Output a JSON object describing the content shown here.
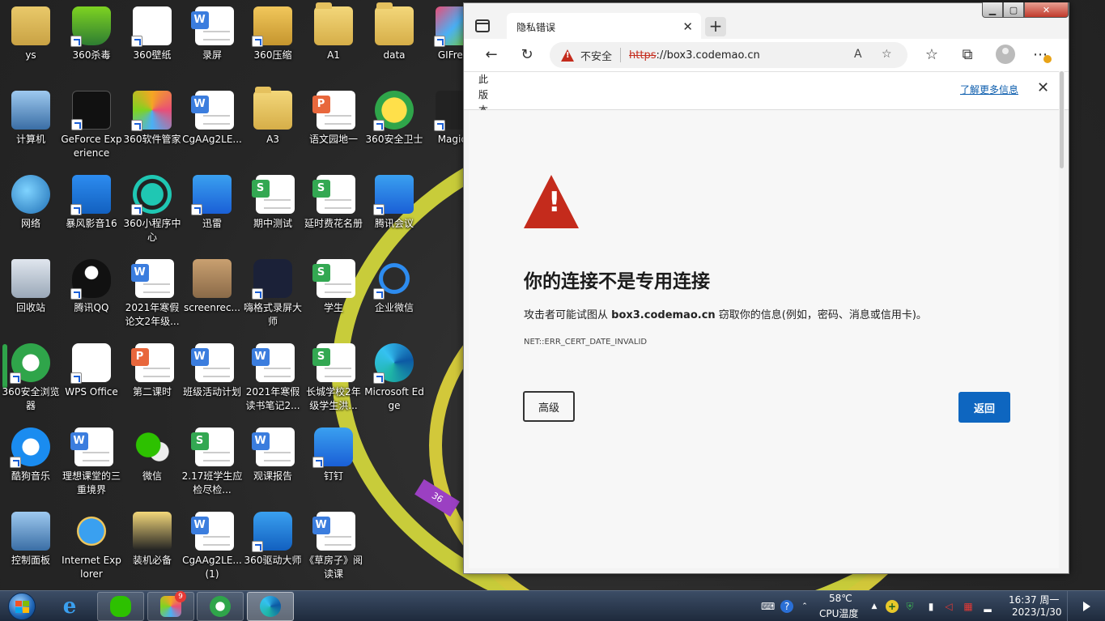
{
  "desktop": {
    "ring_tag": "36",
    "icons": [
      {
        "label": "ys",
        "kind": "user",
        "col": 0,
        "row": 0,
        "shortcut": false
      },
      {
        "label": "360杀毒",
        "kind": "shield-green",
        "col": 1,
        "row": 0,
        "shortcut": true
      },
      {
        "label": "360壁纸",
        "kind": "wallpaper",
        "col": 2,
        "row": 0,
        "shortcut": true
      },
      {
        "label": "录屏",
        "kind": "doc-w",
        "col": 3,
        "row": 0,
        "shortcut": false
      },
      {
        "label": "360压缩",
        "kind": "zip",
        "col": 4,
        "row": 0,
        "shortcut": true
      },
      {
        "label": "A1",
        "kind": "folder",
        "col": 5,
        "row": 0,
        "shortcut": false
      },
      {
        "label": "data",
        "kind": "folder",
        "col": 6,
        "row": 0,
        "shortcut": false
      },
      {
        "label": "GIFrect",
        "kind": "gif",
        "col": 7,
        "row": 0,
        "shortcut": true
      },
      {
        "label": "计算机",
        "kind": "computer",
        "col": 0,
        "row": 1,
        "shortcut": false
      },
      {
        "label": "GeForce Experience",
        "kind": "nvidia",
        "col": 1,
        "row": 1,
        "shortcut": true
      },
      {
        "label": "360软件管家",
        "kind": "360soft",
        "col": 2,
        "row": 1,
        "shortcut": true
      },
      {
        "label": "CgAAg2LE...",
        "kind": "doc-w",
        "col": 3,
        "row": 1,
        "shortcut": false
      },
      {
        "label": "A3",
        "kind": "folder",
        "col": 4,
        "row": 1,
        "shortcut": false
      },
      {
        "label": "语文园地一",
        "kind": "doc-p",
        "col": 5,
        "row": 1,
        "shortcut": false
      },
      {
        "label": "360安全卫士",
        "kind": "360safe",
        "col": 6,
        "row": 1,
        "shortcut": true
      },
      {
        "label": "Magica",
        "kind": "magica",
        "col": 7,
        "row": 1,
        "shortcut": true
      },
      {
        "label": "网络",
        "kind": "network",
        "col": 0,
        "row": 2,
        "shortcut": false
      },
      {
        "label": "暴风影音16",
        "kind": "baofeng",
        "col": 1,
        "row": 2,
        "shortcut": true
      },
      {
        "label": "360小程序中心",
        "kind": "360mini",
        "col": 2,
        "row": 2,
        "shortcut": true
      },
      {
        "label": "迅雷",
        "kind": "xunlei",
        "col": 3,
        "row": 2,
        "shortcut": true
      },
      {
        "label": "期中测试",
        "kind": "doc-s",
        "col": 4,
        "row": 2,
        "shortcut": false
      },
      {
        "label": "延时费花名册",
        "kind": "doc-s",
        "col": 5,
        "row": 2,
        "shortcut": false
      },
      {
        "label": "腾讯会议",
        "kind": "tmeeting",
        "col": 6,
        "row": 2,
        "shortcut": true
      },
      {
        "label": "回收站",
        "kind": "recycle",
        "col": 0,
        "row": 3,
        "shortcut": false
      },
      {
        "label": "腾讯QQ",
        "kind": "qq",
        "col": 1,
        "row": 3,
        "shortcut": true
      },
      {
        "label": "2021年寒假论文2年级...",
        "kind": "doc-w",
        "col": 2,
        "row": 3,
        "shortcut": false
      },
      {
        "label": "screenrec...",
        "kind": "box",
        "col": 3,
        "row": 3,
        "shortcut": false
      },
      {
        "label": "嗨格式录屏大师",
        "kind": "recorder",
        "col": 4,
        "row": 3,
        "shortcut": true
      },
      {
        "label": "学生",
        "kind": "doc-s",
        "col": 5,
        "row": 3,
        "shortcut": false
      },
      {
        "label": "企业微信",
        "kind": "wework",
        "col": 6,
        "row": 3,
        "shortcut": true
      },
      {
        "label": "360安全浏览器",
        "kind": "360browser",
        "col": 0,
        "row": 4,
        "shortcut": true
      },
      {
        "label": "WPS Office",
        "kind": "wps",
        "col": 1,
        "row": 4,
        "shortcut": true
      },
      {
        "label": "第二课时",
        "kind": "doc-p",
        "col": 2,
        "row": 4,
        "shortcut": false
      },
      {
        "label": "班级活动计划",
        "kind": "doc-w",
        "col": 3,
        "row": 4,
        "shortcut": false
      },
      {
        "label": "2021年寒假读书笔记2...",
        "kind": "doc-w",
        "col": 4,
        "row": 4,
        "shortcut": false
      },
      {
        "label": "长城学校2年级学生洪...",
        "kind": "doc-s",
        "col": 5,
        "row": 4,
        "shortcut": false
      },
      {
        "label": "Microsoft Edge",
        "kind": "edge",
        "col": 6,
        "row": 4,
        "shortcut": true
      },
      {
        "label": "酷狗音乐",
        "kind": "kugou",
        "col": 0,
        "row": 5,
        "shortcut": true
      },
      {
        "label": "理想课堂的三重境界",
        "kind": "doc-w",
        "col": 1,
        "row": 5,
        "shortcut": false
      },
      {
        "label": "微信",
        "kind": "wechat",
        "col": 2,
        "row": 5,
        "shortcut": false
      },
      {
        "label": "2.17班学生应检尽检...",
        "kind": "doc-s",
        "col": 3,
        "row": 5,
        "shortcut": false
      },
      {
        "label": "观课报告",
        "kind": "doc-w",
        "col": 4,
        "row": 5,
        "shortcut": false
      },
      {
        "label": "钉钉",
        "kind": "dingtalk",
        "col": 5,
        "row": 5,
        "shortcut": true
      },
      {
        "label": "控制面板",
        "kind": "control",
        "col": 0,
        "row": 6,
        "shortcut": false
      },
      {
        "label": "Internet Explorer",
        "kind": "ie",
        "col": 1,
        "row": 6,
        "shortcut": false
      },
      {
        "label": "装机必备",
        "kind": "folder-dark",
        "col": 2,
        "row": 6,
        "shortcut": false
      },
      {
        "label": "CgAAg2LE...(1)",
        "kind": "doc-w",
        "col": 3,
        "row": 6,
        "shortcut": false
      },
      {
        "label": "360驱动大师",
        "kind": "360driver",
        "col": 4,
        "row": 6,
        "shortcut": true
      },
      {
        "label": "《草房子》阅读课",
        "kind": "doc-w",
        "col": 5,
        "row": 6,
        "shortcut": false
      }
    ]
  },
  "browser": {
    "tab_title": "隐私错误",
    "tab_close": "✕",
    "new_tab": "+",
    "address": {
      "insecure_label": "不安全",
      "scheme": "https",
      "rest": "://box3.codemao.cn"
    },
    "infobar": {
      "vertical_text": "此版本",
      "learn_more": "了解更多信息",
      "close": "✕"
    },
    "error": {
      "title": "你的连接不是专用连接",
      "desc_before": "攻击者可能试图从 ",
      "desc_host": "box3.codemao.cn",
      "desc_after": " 窃取你的信息(例如，密码、消息或信用卡)。",
      "code": "NET::ERR_CERT_DATE_INVALID",
      "advanced_button": "高级",
      "back_button": "返回"
    },
    "window_controls": {
      "min": "▁",
      "max": "▢",
      "close": "✕"
    }
  },
  "taskbar": {
    "temperature": "58℃",
    "cpu_label": "CPU温度",
    "time": "16:37 周一",
    "date": "2023/1/30",
    "badge_360soft": "9"
  },
  "colors": {
    "accent": "#0e66c0",
    "danger": "#c42b1c",
    "link": "#0b5cad"
  }
}
